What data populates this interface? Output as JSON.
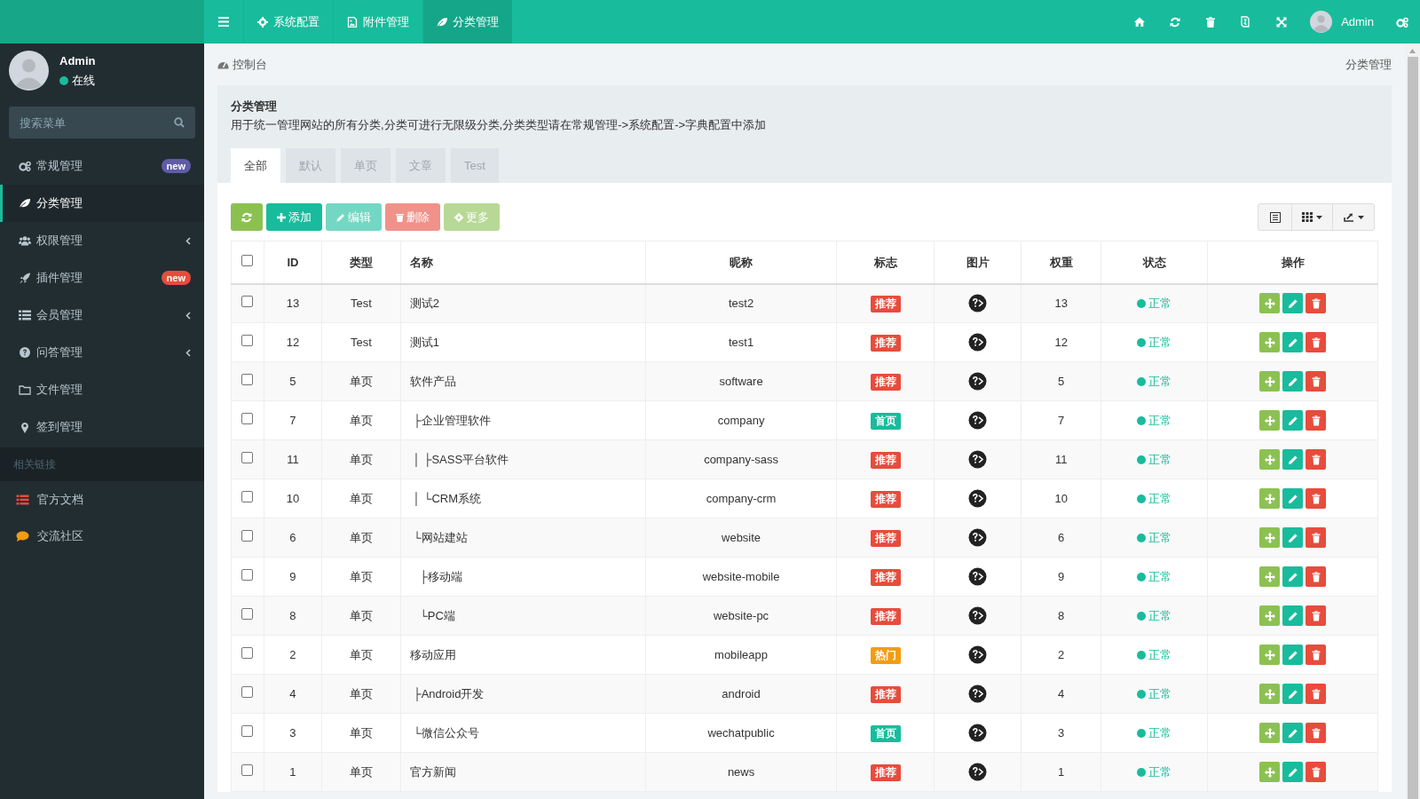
{
  "topbar": {
    "tabs": [
      {
        "label": "系统配置",
        "selected": false
      },
      {
        "label": "附件管理",
        "selected": false
      },
      {
        "label": "分类管理",
        "selected": true
      }
    ],
    "user": "Admin"
  },
  "sidebar": {
    "user": {
      "name": "Admin",
      "status": "在线"
    },
    "search": {
      "placeholder": "搜索菜单"
    },
    "menu": [
      {
        "label": "常规管理",
        "kind": "badge",
        "selected": false,
        "badge": {
          "text": "new",
          "color": "#605ca8"
        }
      },
      {
        "label": "分类管理",
        "kind": "plain",
        "selected": true
      },
      {
        "label": "权限管理",
        "kind": "submenu",
        "selected": false
      },
      {
        "label": "插件管理",
        "kind": "badge",
        "selected": false,
        "badge": {
          "text": "new",
          "color": "#e74c3c"
        }
      },
      {
        "label": "会员管理",
        "kind": "submenu",
        "selected": false
      },
      {
        "label": "问答管理",
        "kind": "submenu",
        "selected": false
      },
      {
        "label": "文件管理",
        "kind": "plain",
        "selected": false
      },
      {
        "label": "签到管理",
        "kind": "plain",
        "selected": false
      }
    ],
    "section_header": "相关链接",
    "links": [
      {
        "label": "官方文档"
      },
      {
        "label": "交流社区"
      }
    ]
  },
  "breadcrumb": {
    "home": "控制台",
    "current": "分类管理"
  },
  "panel": {
    "title": "分类管理",
    "description": "用于统一管理网站的所有分类,分类可进行无限级分类,分类类型请在常规管理->系统配置->字典配置中添加",
    "tabs": [
      {
        "label": "全部",
        "selected": true
      },
      {
        "label": "默认",
        "selected": false
      },
      {
        "label": "单页",
        "selected": false
      },
      {
        "label": "文章",
        "selected": false
      },
      {
        "label": "Test",
        "selected": false
      }
    ]
  },
  "toolbar": {
    "buttons": [
      {
        "kind": "refresh",
        "disabled": false
      },
      {
        "kind": "add",
        "label": "添加",
        "disabled": false
      },
      {
        "kind": "edit",
        "label": "编辑",
        "disabled": true
      },
      {
        "kind": "delete",
        "label": "删除",
        "disabled": true
      },
      {
        "kind": "more",
        "label": "更多",
        "disabled": true
      }
    ]
  },
  "table": {
    "header_checked": false,
    "columns": [
      "ID",
      "类型",
      "名称",
      "昵称",
      "标志",
      "图片",
      "权重",
      "状态",
      "操作"
    ],
    "rows": [
      {
        "checked": false,
        "id": "13",
        "type": "Test",
        "name": "测试2",
        "nickname": "test2",
        "flag": {
          "text": "推荐",
          "color": "#e74c3c"
        },
        "weight": "13",
        "status": "正常"
      },
      {
        "checked": false,
        "id": "12",
        "type": "Test",
        "name": "测试1",
        "nickname": "test1",
        "flag": {
          "text": "推荐",
          "color": "#e74c3c"
        },
        "weight": "12",
        "status": "正常"
      },
      {
        "checked": false,
        "id": "5",
        "type": "单页",
        "name": "软件产品",
        "nickname": "software",
        "flag": {
          "text": "推荐",
          "color": "#e74c3c"
        },
        "weight": "5",
        "status": "正常"
      },
      {
        "checked": false,
        "id": "7",
        "type": "单页",
        "name": " ├企业管理软件",
        "nickname": "company",
        "flag": {
          "text": "首页",
          "color": "#18bc9c"
        },
        "weight": "7",
        "status": "正常"
      },
      {
        "checked": false,
        "id": "11",
        "type": "单页",
        "name": " │ ├SASS平台软件",
        "nickname": "company-sass",
        "flag": {
          "text": "推荐",
          "color": "#e74c3c"
        },
        "weight": "11",
        "status": "正常"
      },
      {
        "checked": false,
        "id": "10",
        "type": "单页",
        "name": " │ └CRM系统",
        "nickname": "company-crm",
        "flag": {
          "text": "推荐",
          "color": "#e74c3c"
        },
        "weight": "10",
        "status": "正常"
      },
      {
        "checked": false,
        "id": "6",
        "type": "单页",
        "name": " └网站建站",
        "nickname": "website",
        "flag": {
          "text": "推荐",
          "color": "#e74c3c"
        },
        "weight": "6",
        "status": "正常"
      },
      {
        "checked": false,
        "id": "9",
        "type": "单页",
        "name": "   ├移动端",
        "nickname": "website-mobile",
        "flag": {
          "text": "推荐",
          "color": "#e74c3c"
        },
        "weight": "9",
        "status": "正常"
      },
      {
        "checked": false,
        "id": "8",
        "type": "单页",
        "name": "   └PC端",
        "nickname": "website-pc",
        "flag": {
          "text": "推荐",
          "color": "#e74c3c"
        },
        "weight": "8",
        "status": "正常"
      },
      {
        "checked": false,
        "id": "2",
        "type": "单页",
        "name": "移动应用",
        "nickname": "mobileapp",
        "flag": {
          "text": "热门",
          "color": "#f39c12"
        },
        "weight": "2",
        "status": "正常"
      },
      {
        "checked": false,
        "id": "4",
        "type": "单页",
        "name": " ├Android开发",
        "nickname": "android",
        "flag": {
          "text": "推荐",
          "color": "#e74c3c"
        },
        "weight": "4",
        "status": "正常"
      },
      {
        "checked": false,
        "id": "3",
        "type": "单页",
        "name": " └微信公众号",
        "nickname": "wechatpublic",
        "flag": {
          "text": "首页",
          "color": "#18bc9c"
        },
        "weight": "3",
        "status": "正常"
      },
      {
        "checked": false,
        "id": "1",
        "type": "单页",
        "name": "官方新闻",
        "nickname": "news",
        "flag": {
          "text": "推荐",
          "color": "#e74c3c"
        },
        "weight": "1",
        "status": "正常"
      }
    ]
  }
}
